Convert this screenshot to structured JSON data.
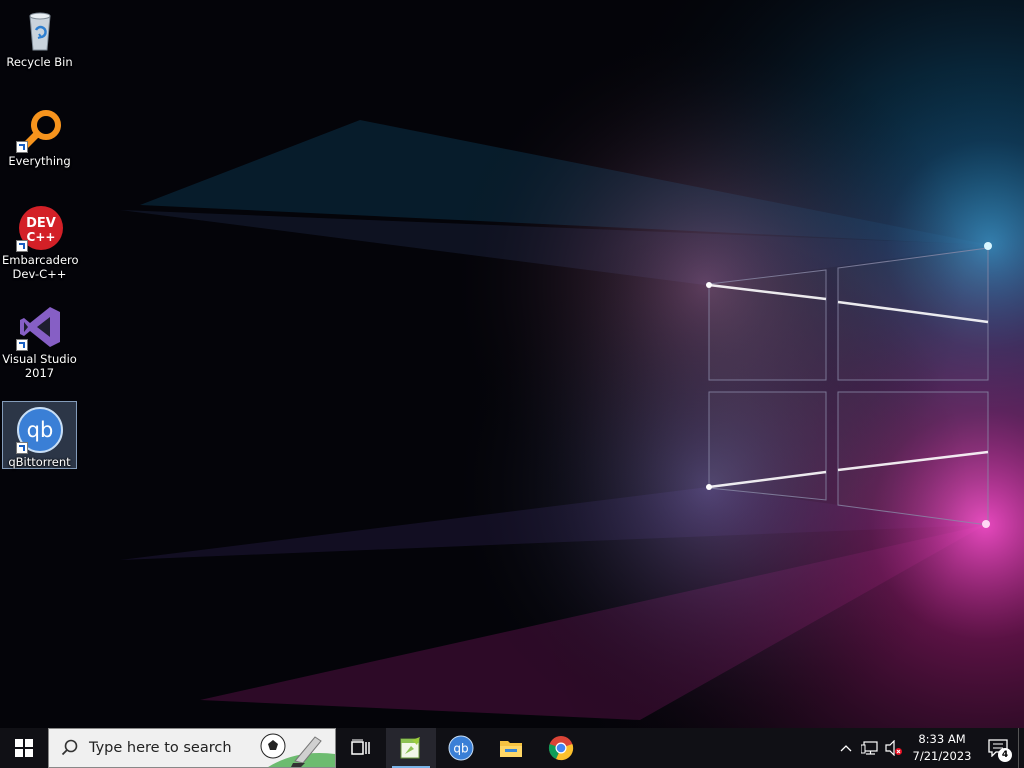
{
  "desktop": {
    "icons": [
      {
        "label": "Recycle Bin",
        "icon": "recycle-bin-icon"
      },
      {
        "label": "Everything",
        "icon": "everything-search-icon"
      },
      {
        "label": "Embarcadero Dev-C++",
        "icon": "dev-cpp-icon"
      },
      {
        "label": "Visual Studio 2017",
        "icon": "visual-studio-icon"
      },
      {
        "label": "qBittorrent",
        "icon": "qbittorrent-icon",
        "selected": true
      }
    ]
  },
  "taskbar": {
    "search_placeholder": "Type here to search",
    "apps": [
      {
        "name": "Task View",
        "icon": "task-view-icon"
      },
      {
        "name": "Notepad++",
        "icon": "notepad-plus-plus-icon",
        "active": true
      },
      {
        "name": "qBittorrent",
        "icon": "qbittorrent-icon"
      },
      {
        "name": "File Explorer",
        "icon": "folder-icon"
      },
      {
        "name": "Google Chrome",
        "icon": "chrome-icon"
      }
    ],
    "tray": {
      "time": "8:33 AM",
      "date": "7/21/2023",
      "notification_count": "4"
    }
  },
  "colors": {
    "taskbar": "#101015",
    "accent": "#7ab4e8"
  }
}
